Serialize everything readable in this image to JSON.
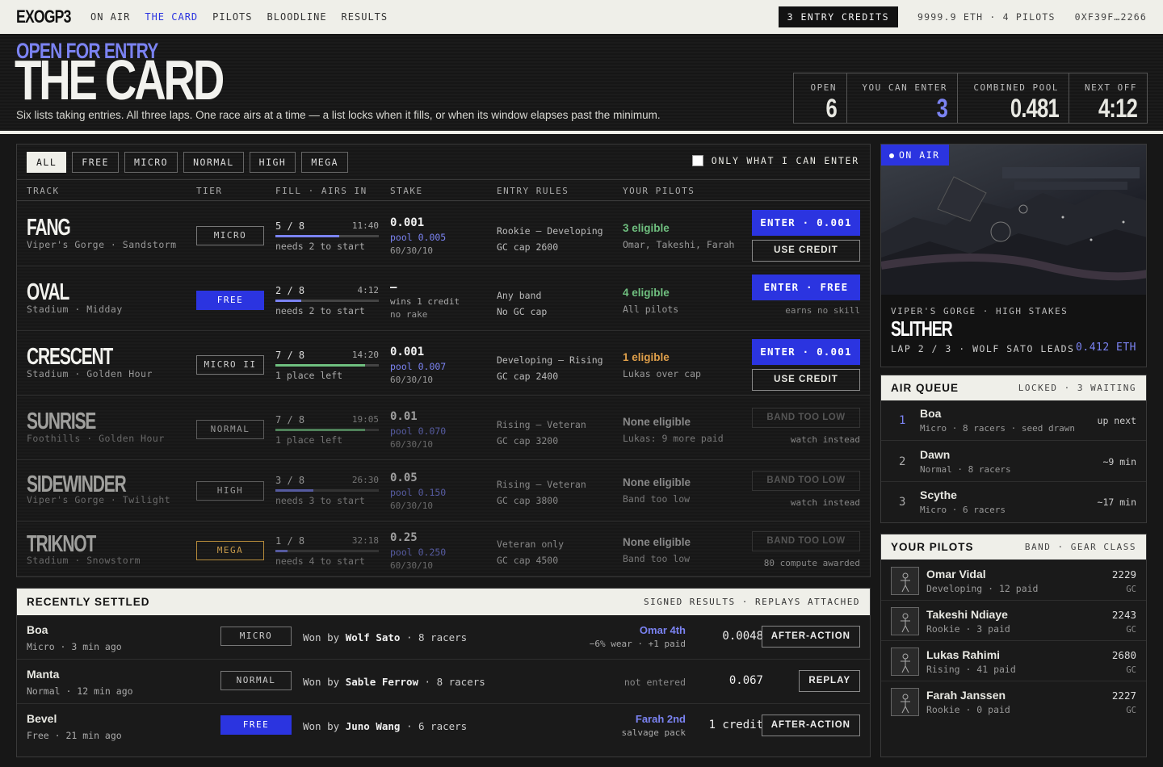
{
  "nav": {
    "brand": "EXOGP3",
    "links": [
      "ON AIR",
      "THE CARD",
      "PILOTS",
      "BLOODLINE",
      "RESULTS"
    ],
    "credits": "3 ENTRY CREDITS",
    "wallet": "9999.9 ETH · 4 PILOTS",
    "address": "0XF39F…2266"
  },
  "header": {
    "kicker": "OPEN FOR ENTRY",
    "title": "THE CARD",
    "subtitle": "Six lists taking entries. All three laps. One race airs at a time — a list locks when it fills, or when its window elapses past the minimum.",
    "stats": [
      {
        "label": "OPEN",
        "value": "6"
      },
      {
        "label": "YOU CAN ENTER",
        "value": "3"
      },
      {
        "label": "COMBINED POOL",
        "value": "0.481"
      },
      {
        "label": "NEXT OFF",
        "value": "4:12"
      }
    ]
  },
  "filters": [
    "ALL",
    "FREE",
    "MICRO",
    "NORMAL",
    "HIGH",
    "MEGA"
  ],
  "only_label": "ONLY WHAT I CAN ENTER",
  "columns": [
    "TRACK",
    "TIER",
    "FILL · AIRS IN",
    "STAKE",
    "ENTRY RULES",
    "YOUR PILOTS"
  ],
  "tracks": [
    {
      "name": "FANG",
      "sub": "Viper's Gorge · Sandstorm",
      "tier": "MICRO",
      "fill": "5 / 8",
      "fill_pct": 62,
      "time": "11:40",
      "note": "needs 2 to start",
      "stake": "0.001",
      "pool": "pool 0.005",
      "split": "60/30/10",
      "rule1": "Rookie – Developing",
      "rule2": "GC cap 2600",
      "eligible": "3 eligible",
      "pilots": "Omar, Takeshi, Farah",
      "btn": "ENTER · 0.001",
      "btn2": "USE CREDIT"
    },
    {
      "name": "OVAL",
      "sub": "Stadium · Midday",
      "tier": "FREE",
      "fill": "2 / 8",
      "fill_pct": 25,
      "time": "4:12",
      "note": "needs 2 to start",
      "stake": "—",
      "pool": "wins 1 credit",
      "split": "no rake",
      "rule1": "Any band",
      "rule2": "No GC cap",
      "eligible": "4 eligible",
      "pilots": "All pilots",
      "btn": "ENTER · FREE",
      "hint": "earns no skill"
    },
    {
      "name": "CRESCENT",
      "sub": "Stadium · Golden Hour",
      "tier": "MICRO II",
      "fill": "7 / 8",
      "fill_pct": 87,
      "time": "14:20",
      "note": "1 place left",
      "stake": "0.001",
      "pool": "pool 0.007",
      "split": "60/30/10",
      "rule1": "Developing – Rising",
      "rule2": "GC cap 2400",
      "eligible": "1 eligible",
      "pilots": "Lukas over cap",
      "btn": "ENTER · 0.001",
      "btn2": "USE CREDIT"
    },
    {
      "name": "SUNRISE",
      "sub": "Foothills · Golden Hour",
      "tier": "NORMAL",
      "fill": "7 / 8",
      "fill_pct": 87,
      "time": "19:05",
      "note": "1 place left",
      "stake": "0.01",
      "pool": "pool 0.070",
      "split": "60/30/10",
      "rule1": "Rising – Veteran",
      "rule2": "GC cap 3200",
      "eligible": "None eligible",
      "pilots": "Lukas: 9 more paid",
      "btn": "BAND TOO LOW",
      "hint": "watch instead"
    },
    {
      "name": "SIDEWINDER",
      "sub": "Viper's Gorge · Twilight",
      "tier": "HIGH",
      "fill": "3 / 8",
      "fill_pct": 37,
      "time": "26:30",
      "note": "needs 3 to start",
      "stake": "0.05",
      "pool": "pool 0.150",
      "split": "60/30/10",
      "rule1": "Rising – Veteran",
      "rule2": "GC cap 3800",
      "eligible": "None eligible",
      "pilots": "Band too low",
      "btn": "BAND TOO LOW",
      "hint": "watch instead"
    },
    {
      "name": "TRIKNOT",
      "sub": "Stadium · Snowstorm",
      "tier": "MEGA",
      "fill": "1 / 8",
      "fill_pct": 12,
      "time": "32:18",
      "note": "needs 4 to start",
      "stake": "0.25",
      "pool": "pool 0.250",
      "split": "60/30/10",
      "rule1": "Veteran only",
      "rule2": "GC cap 4500",
      "eligible": "None eligible",
      "pilots": "Band too low",
      "btn": "BAND TOO LOW",
      "hint": "80 compute awarded"
    }
  ],
  "settled": {
    "title": "RECENTLY SETTLED",
    "meta": "SIGNED RESULTS · REPLAYS ATTACHED",
    "rows": [
      {
        "name": "Boa",
        "sub": "Micro · 3 min ago",
        "tier": "MICRO",
        "won_prefix": "Won by",
        "winner": "Wolf Sato",
        "racers": "· 8 racers",
        "res_a": "Omar 4th",
        "res_b": "−6% wear · +1 paid",
        "amount": "0.0048",
        "btn": "AFTER-ACTION"
      },
      {
        "name": "Manta",
        "sub": "Normal · 12 min ago",
        "tier": "NORMAL",
        "won_prefix": "Won by",
        "winner": "Sable Ferrow",
        "racers": "· 8 racers",
        "res_c": "not entered",
        "amount": "0.067",
        "btn": "REPLAY"
      },
      {
        "name": "Bevel",
        "sub": "Free · 21 min ago",
        "tier": "FREE",
        "won_prefix": "Won by",
        "winner": "Juno Wang",
        "racers": "· 6 racers",
        "res_a": "Farah 2nd",
        "res_b": "salvage pack",
        "amount": "1 credit",
        "btn": "AFTER-ACTION"
      }
    ]
  },
  "onair": {
    "badge": "ON AIR",
    "track": "VIPER'S GORGE · HIGH STAKES",
    "name": "SLITHER",
    "lap": "LAP 2 / 3 · WOLF SATO LEADS",
    "eth": "0.412 ETH"
  },
  "queue": {
    "title": "AIR QUEUE",
    "meta": "LOCKED · 3 WAITING",
    "rows": [
      {
        "n": "1",
        "name": "Boa",
        "sub": "Micro · 8 racers · seed drawn",
        "right": "up next"
      },
      {
        "n": "2",
        "name": "Dawn",
        "sub": "Normal · 8 racers",
        "right": "~9 min"
      },
      {
        "n": "3",
        "name": "Scythe",
        "sub": "Micro · 6 racers",
        "right": "~17 min"
      }
    ]
  },
  "your_pilots": {
    "title": "YOUR PILOTS",
    "meta": "BAND · GEAR CLASS",
    "rows": [
      {
        "name": "Omar Vidal",
        "sub": "Developing · 12 paid",
        "gc": "2229",
        "unit": "GC"
      },
      {
        "name": "Takeshi Ndiaye",
        "sub": "Rookie · 3 paid",
        "gc": "2243",
        "unit": "GC"
      },
      {
        "name": "Lukas Rahimi",
        "sub": "Rising · 41 paid",
        "gc": "2680",
        "unit": "GC"
      },
      {
        "name": "Farah Janssen",
        "sub": "Rookie · 0 paid",
        "gc": "2227",
        "unit": "GC"
      }
    ]
  }
}
